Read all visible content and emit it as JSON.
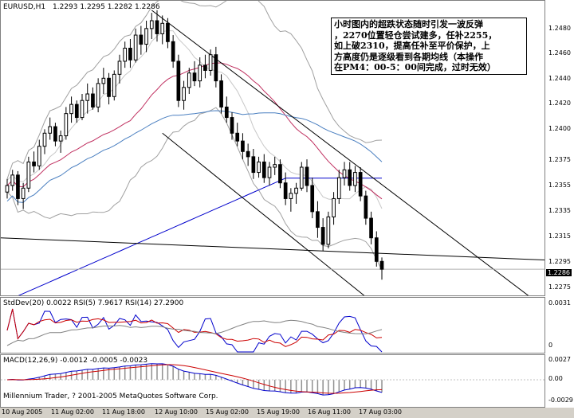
{
  "window": {
    "symbol_label": "EURUSD,H1",
    "ohlc_label": "1.2293 1.2295 1.2282 1.2286"
  },
  "annotation": {
    "lines": [
      "小时图内的超跌状态随时引发一波反弹",
      "，2270位置轻仓尝试建多，任补2255，",
      "如上破2310，提高任补至平价保护，上",
      "方高度仍是逐级看到各期均线（本操作",
      "在PM4：00-5：00间完成，过时无效）"
    ]
  },
  "price_axis": {
    "ticks": [
      "1.2480",
      "1.2460",
      "1.2440",
      "1.2420",
      "1.2400",
      "1.2375",
      "1.2355",
      "1.2335",
      "1.2315",
      "1.2295",
      "1.2275"
    ],
    "current_price": "1.2286"
  },
  "rsi_panel": {
    "label": "StdDev(20) 0.0022  RSI(5) 7.9617  RSI(14) 27.2900",
    "ticks": [
      "0.0031",
      "0"
    ]
  },
  "macd_panel": {
    "label": "MACD(12,26,9) -0.0012 -0.0005 -0.0023",
    "ticks": [
      "0.0027",
      "0.00",
      "-0.0029"
    ]
  },
  "footer": {
    "copyright": "Millennium Trader, ? 2001-2005 MetaQuotes Software Corp."
  },
  "time_axis": {
    "labels": [
      "10 Aug 2005",
      "11 Aug 02:00",
      "11 Aug 18:00",
      "12 Aug 10:00",
      "15 Aug 02:00",
      "15 Aug 19:00",
      "16 Aug 11:00",
      "17 Aug 03:00"
    ]
  },
  "chart_data": {
    "type": "candlestick",
    "symbol": "EURUSD",
    "timeframe": "H1",
    "ylim": [
      1.2266,
      1.249
    ],
    "candles": [
      [
        1.2345,
        1.2355,
        1.234,
        1.235
      ],
      [
        1.235,
        1.2362,
        1.2346,
        1.2358
      ],
      [
        1.2358,
        1.2361,
        1.2335,
        1.234
      ],
      [
        1.234,
        1.2352,
        1.2332,
        1.2348
      ],
      [
        1.2348,
        1.2372,
        1.2345,
        1.2368
      ],
      [
        1.2368,
        1.2376,
        1.236,
        1.2365
      ],
      [
        1.2365,
        1.2385,
        1.2362,
        1.238
      ],
      [
        1.238,
        1.2393,
        1.2374,
        1.239
      ],
      [
        1.239,
        1.2402,
        1.2385,
        1.2395
      ],
      [
        1.2395,
        1.2398,
        1.238,
        1.2384
      ],
      [
        1.2384,
        1.2392,
        1.2375,
        1.2388
      ],
      [
        1.2388,
        1.241,
        1.2385,
        1.2405
      ],
      [
        1.2405,
        1.2418,
        1.2398,
        1.2412
      ],
      [
        1.2412,
        1.2415,
        1.2398,
        1.2402
      ],
      [
        1.2402,
        1.242,
        1.24,
        1.2415
      ],
      [
        1.2415,
        1.2428,
        1.2405,
        1.242
      ],
      [
        1.242,
        1.2425,
        1.2408,
        1.241
      ],
      [
        1.241,
        1.2432,
        1.2406,
        1.2428
      ],
      [
        1.2428,
        1.244,
        1.242,
        1.2432
      ],
      [
        1.2432,
        1.2436,
        1.2412,
        1.2418
      ],
      [
        1.2418,
        1.2438,
        1.2415,
        1.2435
      ],
      [
        1.2435,
        1.245,
        1.2428,
        1.2445
      ],
      [
        1.2445,
        1.246,
        1.244,
        1.2455
      ],
      [
        1.2455,
        1.2462,
        1.244,
        1.2446
      ],
      [
        1.2446,
        1.247,
        1.2444,
        1.2465
      ],
      [
        1.2465,
        1.2472,
        1.245,
        1.2458
      ],
      [
        1.2458,
        1.2476,
        1.2452,
        1.247
      ],
      [
        1.247,
        1.2482,
        1.2462,
        1.2476
      ],
      [
        1.2476,
        1.2484,
        1.246,
        1.2466
      ],
      [
        1.2466,
        1.248,
        1.2458,
        1.2474
      ],
      [
        1.2474,
        1.2478,
        1.2455,
        1.246
      ],
      [
        1.246,
        1.2465,
        1.244,
        1.2445
      ],
      [
        1.2445,
        1.245,
        1.241,
        1.2415
      ],
      [
        1.2415,
        1.243,
        1.2408,
        1.2425
      ],
      [
        1.2425,
        1.244,
        1.242,
        1.2436
      ],
      [
        1.2436,
        1.2445,
        1.2426,
        1.243
      ],
      [
        1.243,
        1.2448,
        1.2425,
        1.2442
      ],
      [
        1.2442,
        1.245,
        1.2432,
        1.2438
      ],
      [
        1.2438,
        1.2454,
        1.2434,
        1.245
      ],
      [
        1.245,
        1.2456,
        1.2425,
        1.243
      ],
      [
        1.243,
        1.2435,
        1.2405,
        1.241
      ],
      [
        1.241,
        1.2418,
        1.2398,
        1.2402
      ],
      [
        1.2402,
        1.2406,
        1.2385,
        1.239
      ],
      [
        1.239,
        1.2398,
        1.238,
        1.2384
      ],
      [
        1.2384,
        1.239,
        1.237,
        1.2376
      ],
      [
        1.2376,
        1.2382,
        1.2365,
        1.2372
      ],
      [
        1.2372,
        1.2378,
        1.2355,
        1.236
      ],
      [
        1.236,
        1.2372,
        1.2356,
        1.2368
      ],
      [
        1.2368,
        1.2374,
        1.2352,
        1.2356
      ],
      [
        1.2356,
        1.2368,
        1.235,
        1.2364
      ],
      [
        1.2364,
        1.2372,
        1.2358,
        1.2366
      ],
      [
        1.2366,
        1.237,
        1.2348,
        1.2352
      ],
      [
        1.2352,
        1.236,
        1.2335,
        1.234
      ],
      [
        1.234,
        1.2348,
        1.233,
        1.2344
      ],
      [
        1.2344,
        1.2352,
        1.2336,
        1.2348
      ],
      [
        1.2348,
        1.2368,
        1.2346,
        1.2364
      ],
      [
        1.2364,
        1.237,
        1.2345,
        1.235
      ],
      [
        1.235,
        1.2356,
        1.2325,
        1.233
      ],
      [
        1.233,
        1.2338,
        1.231,
        1.2318
      ],
      [
        1.2318,
        1.2325,
        1.23,
        1.2305
      ],
      [
        1.2305,
        1.233,
        1.2302,
        1.2326
      ],
      [
        1.2326,
        1.2345,
        1.232,
        1.234
      ],
      [
        1.234,
        1.2362,
        1.2336,
        1.2356
      ],
      [
        1.2356,
        1.2368,
        1.235,
        1.2362
      ],
      [
        1.2362,
        1.2368,
        1.2346,
        1.235
      ],
      [
        1.235,
        1.2365,
        1.2345,
        1.236
      ],
      [
        1.236,
        1.2364,
        1.2338,
        1.2342
      ],
      [
        1.2342,
        1.2346,
        1.232,
        1.2325
      ],
      [
        1.2325,
        1.233,
        1.2305,
        1.231
      ],
      [
        1.231,
        1.2315,
        1.2288,
        1.2292
      ],
      [
        1.2292,
        1.2295,
        1.2278,
        1.2286
      ]
    ]
  },
  "colors": {
    "background": "#ffffff",
    "bull": "#ffffff",
    "bear": "#000000",
    "channel": "#000000",
    "ma_slow": "#0000cc",
    "ma_mid": "#4a7fc0",
    "ma_fast": "#c03060",
    "bands": "#a0a0a0",
    "rsi_fast": "#0000cc",
    "rsi_slow": "#cc0000",
    "stddev": "#808080",
    "macd": "#0000cc",
    "signal": "#cc0000"
  }
}
